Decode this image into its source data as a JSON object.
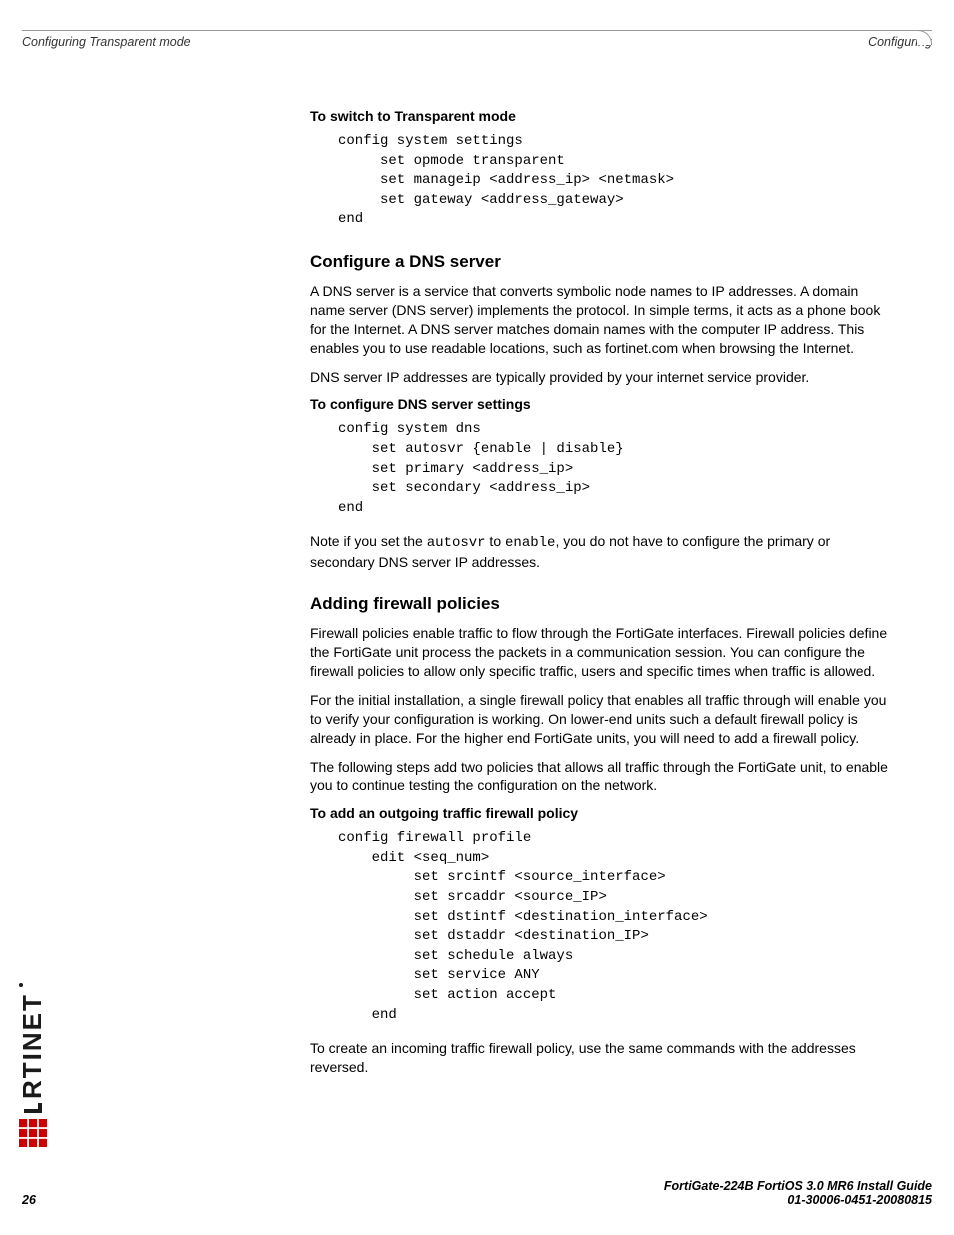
{
  "header": {
    "left": "Configuring Transparent mode",
    "right": "Configuring"
  },
  "sections": {
    "switch_mode": {
      "title": "To switch to Transparent mode",
      "code": "config system settings\n     set opmode transparent\n     set manageip <address_ip> <netmask>\n     set gateway <address_gateway>\nend"
    },
    "dns": {
      "title": "Configure a DNS server",
      "para1": "A DNS server is a service that converts symbolic node names to IP addresses. A domain name server (DNS server) implements the protocol. In simple terms, it acts as a phone book for the Internet. A DNS server matches domain names with the computer IP address. This enables you to use readable locations, such as fortinet.com when browsing the Internet.",
      "para2": "DNS server IP addresses are typically provided by your internet service provider.",
      "proc_title": "To configure DNS server settings",
      "code": "config system dns\n    set autosvr {enable | disable}\n    set primary <address_ip>\n    set secondary <address_ip>\nend",
      "note_pre": "Note if you set the ",
      "note_mono1": "autosvr",
      "note_mid": " to ",
      "note_mono2": "enable",
      "note_post": ", you do not have to configure the primary or secondary DNS server IP addresses."
    },
    "firewall": {
      "title": "Adding firewall policies",
      "para1": "Firewall policies enable traffic to flow through the FortiGate interfaces. Firewall policies define the FortiGate unit process the packets in a communication session. You can configure the firewall policies to allow only specific traffic, users and specific times when traffic is allowed.",
      "para2": "For the initial installation, a single firewall policy that enables all traffic through will enable you to verify your configuration is working. On lower-end units such a default firewall policy is already in place. For the higher end FortiGate units, you will need to add a firewall policy.",
      "para3": "The following steps add two policies that allows all traffic through the FortiGate unit, to enable you to continue testing the configuration on the network.",
      "proc_title": "To add an outgoing traffic firewall policy",
      "code": "config firewall profile\n    edit <seq_num>\n         set srcintf <source_interface>\n         set srcaddr <source_IP>\n         set dstintf <destination_interface>\n         set dstaddr <destination_IP>\n         set schedule always\n         set service ANY\n         set action accept\n    end",
      "para4": "To create an incoming traffic firewall policy, use the same commands with the addresses reversed."
    }
  },
  "footer": {
    "page": "26",
    "doc_title": "FortiGate-224B FortiOS 3.0 MR6 Install Guide",
    "doc_num": "01-30006-0451-20080815"
  },
  "logo_text": "RTINET"
}
